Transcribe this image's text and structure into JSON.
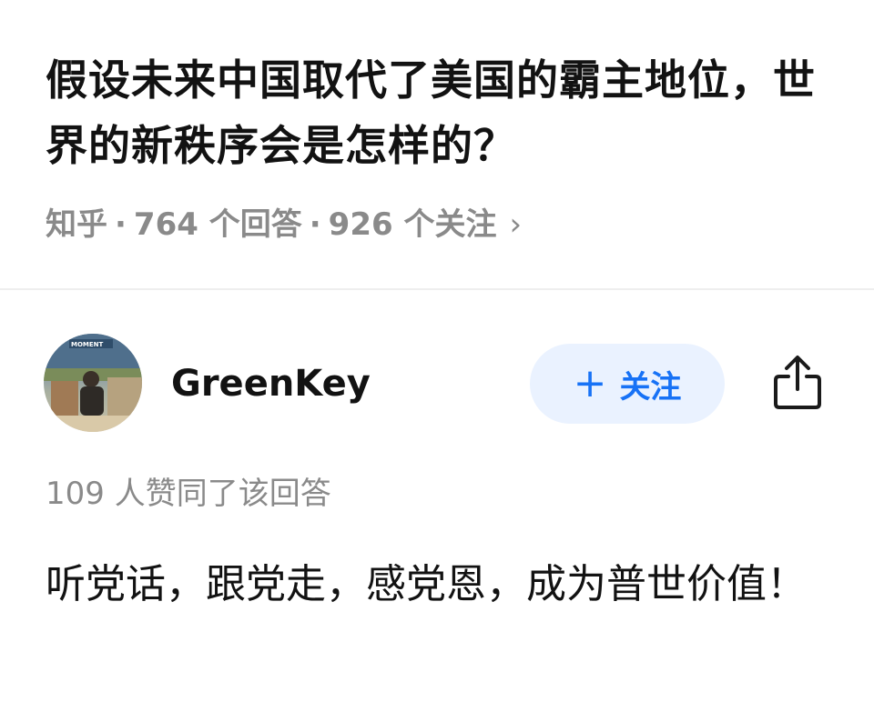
{
  "question": {
    "title": "假设未来中国取代了美国的霸主地位，世界的新秩序会是怎样的？",
    "meta": {
      "source": "知乎",
      "answers": "764 个回答",
      "followers": "926 个关注",
      "chevron": "›"
    }
  },
  "author": {
    "name": "GreenKey",
    "avatar_text": "MOMENT",
    "follow_plus": "+",
    "follow_label": "关注",
    "share_icon": "share-icon"
  },
  "answer": {
    "vote_summary": "109 人赞同了该回答",
    "content": "听党话，跟党走，感党恩，成为普世价值！"
  },
  "colors": {
    "accent": "#1772f6",
    "follow_bg": "#eaf2ff",
    "meta_text": "#8a8a8a"
  }
}
